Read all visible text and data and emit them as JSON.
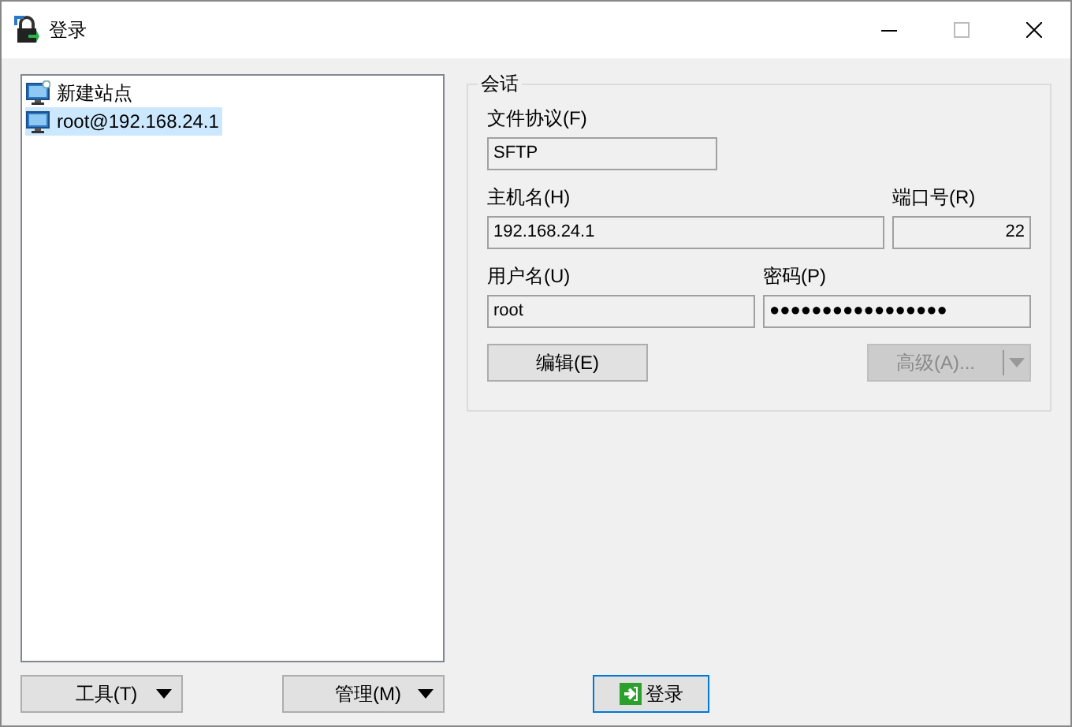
{
  "window": {
    "title": "登录"
  },
  "sites": [
    {
      "label": "新建站点",
      "kind": "new",
      "selected": false
    },
    {
      "label": "root@192.168.24.1",
      "kind": "site",
      "selected": true
    }
  ],
  "left_buttons": [
    "工具(T)",
    "管理(M)"
  ],
  "session": {
    "title": "会话",
    "protocol": {
      "label": "文件协议(F)",
      "value": "SFTP"
    },
    "host": {
      "label": "主机名(H)",
      "value": "192.168.24.1"
    },
    "port": {
      "label": "端口号(R)",
      "value": "22"
    },
    "user": {
      "label": "用户名(U)",
      "value": "root"
    },
    "password": {
      "label": "密码(P)",
      "value": "●●●●●●●●●●●●●●●●●"
    },
    "edit_button": {
      "label": "编辑(E)",
      "disabled": false
    },
    "advanced_button": {
      "label": "高级(A)...",
      "disabled": true
    }
  },
  "login_button": {
    "label": "登录"
  }
}
